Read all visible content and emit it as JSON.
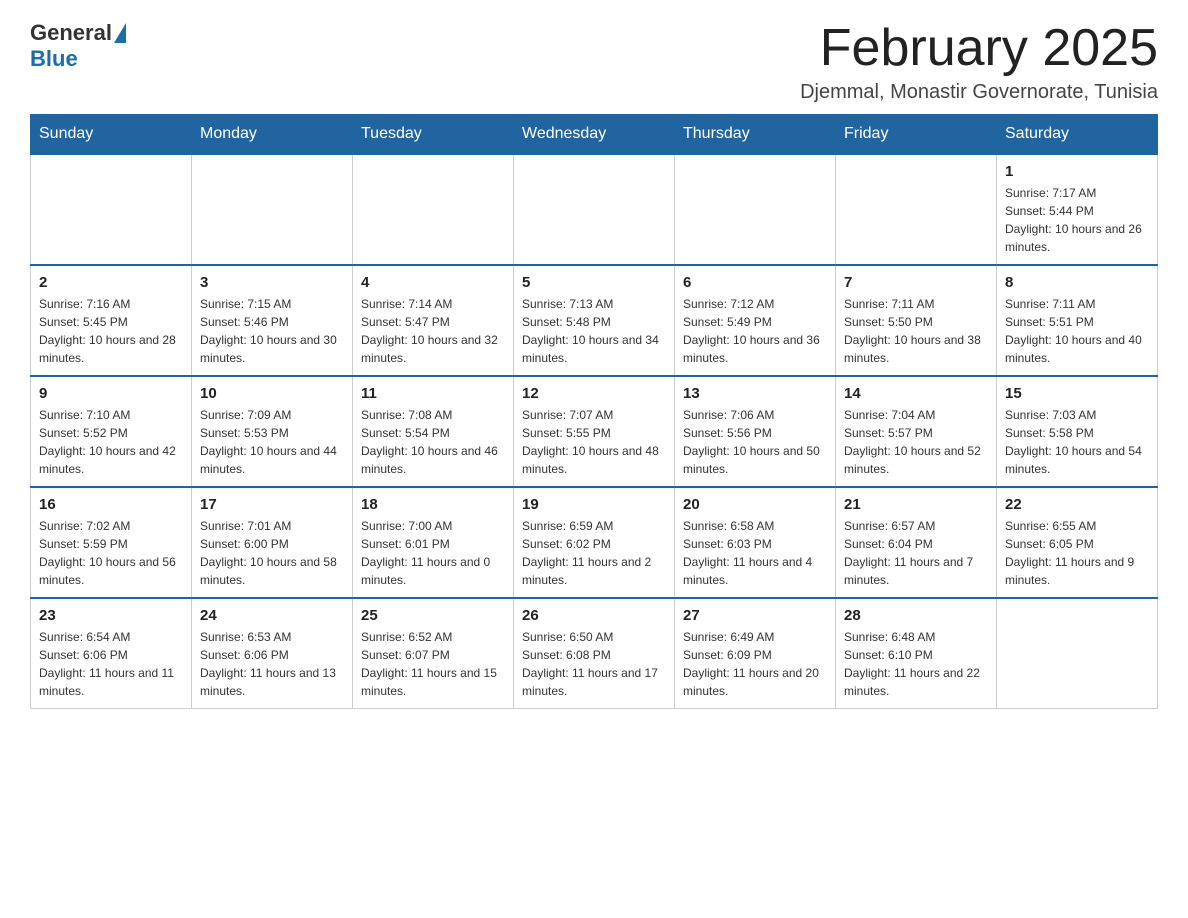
{
  "header": {
    "logo_general": "General",
    "logo_blue": "Blue",
    "month_title": "February 2025",
    "location": "Djemmal, Monastir Governorate, Tunisia"
  },
  "weekdays": [
    "Sunday",
    "Monday",
    "Tuesday",
    "Wednesday",
    "Thursday",
    "Friday",
    "Saturday"
  ],
  "weeks": [
    [
      {
        "day": "",
        "info": ""
      },
      {
        "day": "",
        "info": ""
      },
      {
        "day": "",
        "info": ""
      },
      {
        "day": "",
        "info": ""
      },
      {
        "day": "",
        "info": ""
      },
      {
        "day": "",
        "info": ""
      },
      {
        "day": "1",
        "info": "Sunrise: 7:17 AM\nSunset: 5:44 PM\nDaylight: 10 hours and 26 minutes."
      }
    ],
    [
      {
        "day": "2",
        "info": "Sunrise: 7:16 AM\nSunset: 5:45 PM\nDaylight: 10 hours and 28 minutes."
      },
      {
        "day": "3",
        "info": "Sunrise: 7:15 AM\nSunset: 5:46 PM\nDaylight: 10 hours and 30 minutes."
      },
      {
        "day": "4",
        "info": "Sunrise: 7:14 AM\nSunset: 5:47 PM\nDaylight: 10 hours and 32 minutes."
      },
      {
        "day": "5",
        "info": "Sunrise: 7:13 AM\nSunset: 5:48 PM\nDaylight: 10 hours and 34 minutes."
      },
      {
        "day": "6",
        "info": "Sunrise: 7:12 AM\nSunset: 5:49 PM\nDaylight: 10 hours and 36 minutes."
      },
      {
        "day": "7",
        "info": "Sunrise: 7:11 AM\nSunset: 5:50 PM\nDaylight: 10 hours and 38 minutes."
      },
      {
        "day": "8",
        "info": "Sunrise: 7:11 AM\nSunset: 5:51 PM\nDaylight: 10 hours and 40 minutes."
      }
    ],
    [
      {
        "day": "9",
        "info": "Sunrise: 7:10 AM\nSunset: 5:52 PM\nDaylight: 10 hours and 42 minutes."
      },
      {
        "day": "10",
        "info": "Sunrise: 7:09 AM\nSunset: 5:53 PM\nDaylight: 10 hours and 44 minutes."
      },
      {
        "day": "11",
        "info": "Sunrise: 7:08 AM\nSunset: 5:54 PM\nDaylight: 10 hours and 46 minutes."
      },
      {
        "day": "12",
        "info": "Sunrise: 7:07 AM\nSunset: 5:55 PM\nDaylight: 10 hours and 48 minutes."
      },
      {
        "day": "13",
        "info": "Sunrise: 7:06 AM\nSunset: 5:56 PM\nDaylight: 10 hours and 50 minutes."
      },
      {
        "day": "14",
        "info": "Sunrise: 7:04 AM\nSunset: 5:57 PM\nDaylight: 10 hours and 52 minutes."
      },
      {
        "day": "15",
        "info": "Sunrise: 7:03 AM\nSunset: 5:58 PM\nDaylight: 10 hours and 54 minutes."
      }
    ],
    [
      {
        "day": "16",
        "info": "Sunrise: 7:02 AM\nSunset: 5:59 PM\nDaylight: 10 hours and 56 minutes."
      },
      {
        "day": "17",
        "info": "Sunrise: 7:01 AM\nSunset: 6:00 PM\nDaylight: 10 hours and 58 minutes."
      },
      {
        "day": "18",
        "info": "Sunrise: 7:00 AM\nSunset: 6:01 PM\nDaylight: 11 hours and 0 minutes."
      },
      {
        "day": "19",
        "info": "Sunrise: 6:59 AM\nSunset: 6:02 PM\nDaylight: 11 hours and 2 minutes."
      },
      {
        "day": "20",
        "info": "Sunrise: 6:58 AM\nSunset: 6:03 PM\nDaylight: 11 hours and 4 minutes."
      },
      {
        "day": "21",
        "info": "Sunrise: 6:57 AM\nSunset: 6:04 PM\nDaylight: 11 hours and 7 minutes."
      },
      {
        "day": "22",
        "info": "Sunrise: 6:55 AM\nSunset: 6:05 PM\nDaylight: 11 hours and 9 minutes."
      }
    ],
    [
      {
        "day": "23",
        "info": "Sunrise: 6:54 AM\nSunset: 6:06 PM\nDaylight: 11 hours and 11 minutes."
      },
      {
        "day": "24",
        "info": "Sunrise: 6:53 AM\nSunset: 6:06 PM\nDaylight: 11 hours and 13 minutes."
      },
      {
        "day": "25",
        "info": "Sunrise: 6:52 AM\nSunset: 6:07 PM\nDaylight: 11 hours and 15 minutes."
      },
      {
        "day": "26",
        "info": "Sunrise: 6:50 AM\nSunset: 6:08 PM\nDaylight: 11 hours and 17 minutes."
      },
      {
        "day": "27",
        "info": "Sunrise: 6:49 AM\nSunset: 6:09 PM\nDaylight: 11 hours and 20 minutes."
      },
      {
        "day": "28",
        "info": "Sunrise: 6:48 AM\nSunset: 6:10 PM\nDaylight: 11 hours and 22 minutes."
      },
      {
        "day": "",
        "info": ""
      }
    ]
  ]
}
